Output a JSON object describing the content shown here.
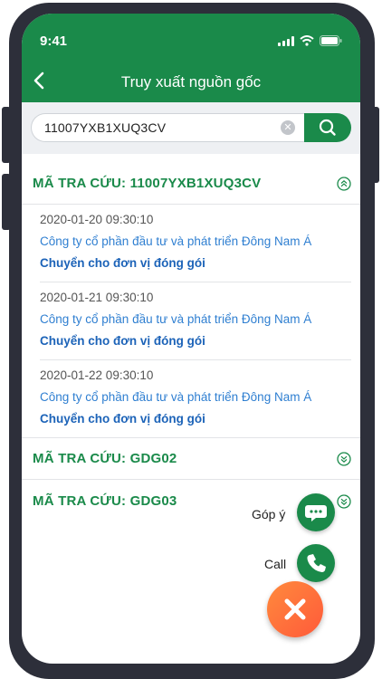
{
  "status": {
    "time": "9:41"
  },
  "header": {
    "title": "Truy xuất nguồn gốc"
  },
  "search": {
    "value": "11007YXB1XUQ3CV"
  },
  "sections": [
    {
      "title": "MÃ TRA CỨU: 11007YXB1XUQ3CV",
      "expanded": true,
      "entries": [
        {
          "date": "2020-01-20 09:30:10",
          "company": "Công ty cổ phần đầu tư và phát triển Đông Nam Á",
          "action": "Chuyển cho đơn vị đóng gói"
        },
        {
          "date": "2020-01-21 09:30:10",
          "company": "Công ty cổ phần đầu tư và phát triển Đông Nam Á",
          "action": "Chuyển cho đơn vị đóng gói"
        },
        {
          "date": "2020-01-22 09:30:10",
          "company": "Công ty cổ phần đầu tư và phát triển Đông Nam Á",
          "action": "Chuyển cho đơn vị đóng gói"
        }
      ]
    },
    {
      "title": "MÃ TRA CỨU: GDG02",
      "expanded": false
    },
    {
      "title": "MÃ TRA CỨU: GDG03",
      "expanded": false
    }
  ],
  "fab": {
    "feedback_label": "Góp ý",
    "call_label": "Call"
  },
  "colors": {
    "primary": "#1a8a4a",
    "link": "#2f7fd1",
    "close": "#ff6a3a"
  }
}
